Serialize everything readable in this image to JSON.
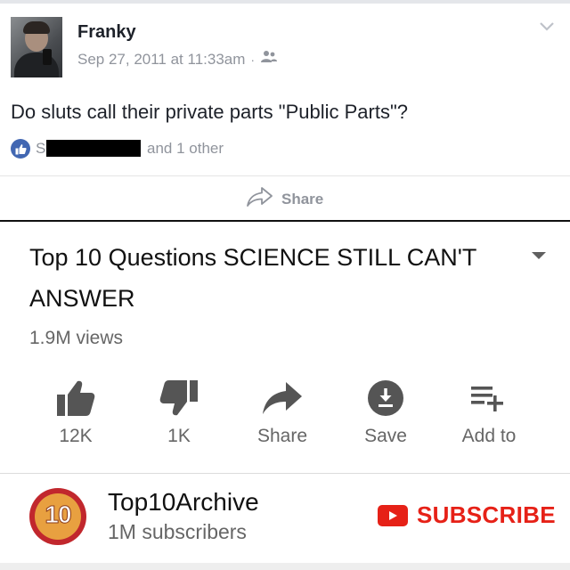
{
  "fb_post": {
    "author": "Franky",
    "timestamp": "Sep 27, 2011 at 11:33am",
    "separator": "·",
    "audience_icon": "friends-icon",
    "text": "Do sluts call their private parts \"Public Parts\"?",
    "reaction_initial": "S",
    "reaction_suffix": "and 1 other",
    "share_label": "Share",
    "colors": {
      "like_badge": "#4267b2",
      "meta_text": "#90949c"
    }
  },
  "youtube": {
    "title": "Top 10 Questions SCIENCE STILL CAN'T ANSWER",
    "views": "1.9M views",
    "actions": [
      {
        "icon": "thumbs-up-icon",
        "label": "12K"
      },
      {
        "icon": "thumbs-down-icon",
        "label": "1K"
      },
      {
        "icon": "share-arrow-icon",
        "label": "Share"
      },
      {
        "icon": "download-icon",
        "label": "Save"
      },
      {
        "icon": "add-to-playlist-icon",
        "label": "Add to"
      }
    ],
    "channel": {
      "logo_text": "10",
      "name": "Top10Archive",
      "subscribers": "1M subscribers"
    },
    "subscribe_label": "SUBSCRIBE",
    "colors": {
      "subscribe": "#e62117",
      "icon": "#555555"
    }
  }
}
